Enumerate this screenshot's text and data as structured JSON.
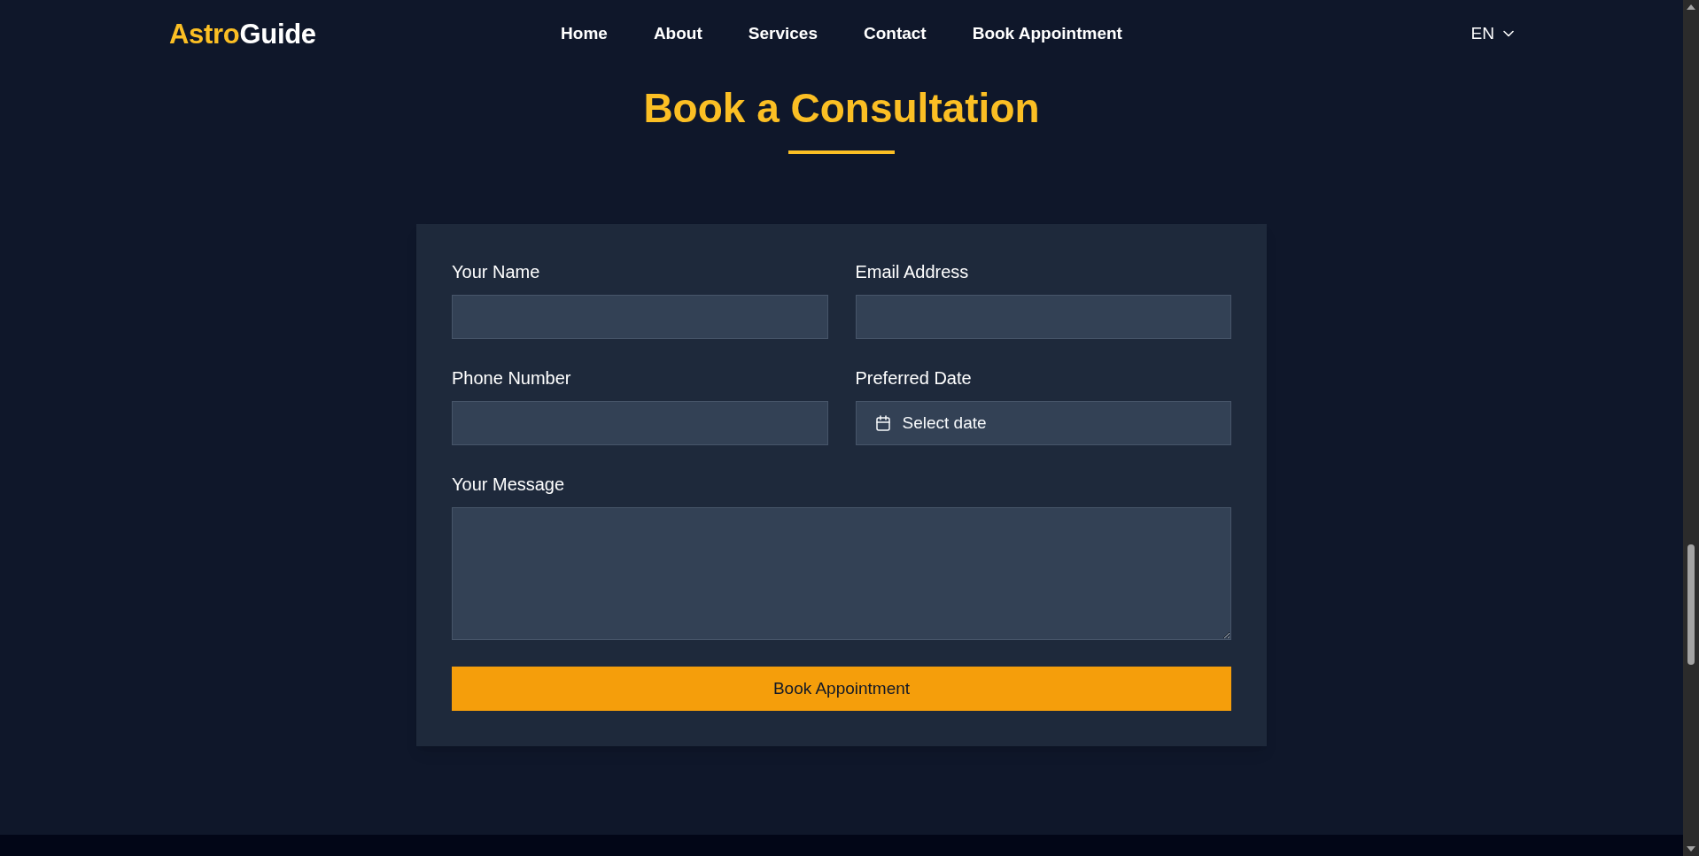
{
  "header": {
    "logo": {
      "accent": "Astro",
      "rest": "Guide"
    },
    "nav": [
      {
        "label": "Home"
      },
      {
        "label": "About"
      },
      {
        "label": "Services"
      },
      {
        "label": "Contact"
      },
      {
        "label": "Book Appointment"
      }
    ],
    "language": "EN"
  },
  "page_title": "Book a Consultation",
  "form": {
    "fields": [
      {
        "kind": "text",
        "label": "Your Name"
      },
      {
        "kind": "text",
        "label": "Email Address"
      },
      {
        "kind": "text",
        "label": "Phone Number"
      },
      {
        "kind": "date",
        "label": "Preferred Date",
        "placeholder": "Select date"
      },
      {
        "kind": "textarea",
        "label": "Your Message"
      }
    ],
    "submit": "Book Appointment"
  }
}
